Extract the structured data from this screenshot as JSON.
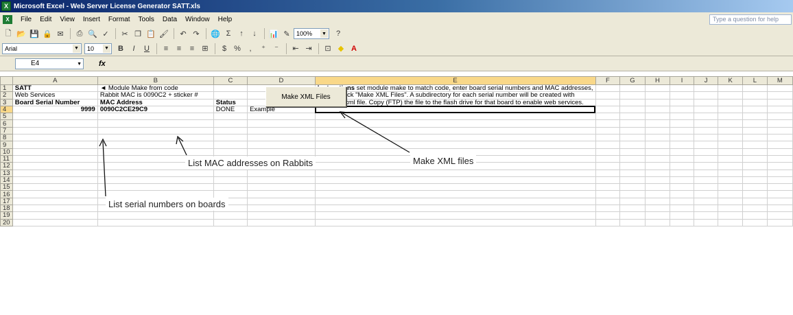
{
  "window": {
    "title": "Microsoft Excel - Web Server License Generator SATT.xls",
    "app_badge": "X"
  },
  "menu": {
    "items": [
      "File",
      "Edit",
      "View",
      "Insert",
      "Format",
      "Tools",
      "Data",
      "Window",
      "Help"
    ],
    "help_placeholder": "Type a question for help"
  },
  "toolbar": {
    "zoom": "100%",
    "font_name": "Arial",
    "font_size": "10",
    "bold": "B",
    "italic": "I",
    "underline": "U",
    "currency": "$",
    "percent": "%",
    "comma": ","
  },
  "formula_bar": {
    "name_box": "E4",
    "fx": "fx",
    "content": ""
  },
  "grid": {
    "columns": [
      "A",
      "B",
      "C",
      "D",
      "E",
      "F",
      "G",
      "H",
      "I",
      "J",
      "K",
      "L",
      "M"
    ],
    "selected_column": "E",
    "selected_row": "4",
    "rows": [
      "1",
      "2",
      "3",
      "4",
      "5",
      "6",
      "7",
      "8",
      "9",
      "10",
      "11",
      "12",
      "13",
      "14",
      "15",
      "16",
      "17",
      "18",
      "19",
      "20"
    ],
    "cells": {
      "A1": "SATT",
      "A2": "Web Services",
      "A3": "Board Serial Number",
      "A4": "9999",
      "B1": "◄ Module Make from code",
      "B2": "Rabbit MAC is 0090C2 + sticker #",
      "B3": "MAC Address",
      "B4": "0090C2CE29C9",
      "C3": "Status",
      "C4": "DONE",
      "D4": "Example",
      "E1_bold": "Instructions",
      "E1": " set module make to match code, enter board serial numbers and MAC addresses,",
      "E2": "then on click \"Make XML Files\".  A subdirectory for each serial number will be created with",
      "E3": "a license xml file.  Copy (FTP) the file to the flash drive for that board to enable web services."
    }
  },
  "button": {
    "make_xml": "Make XML Files"
  },
  "annotations": {
    "mac": "List MAC addresses on Rabbits",
    "xml": "Make XML files",
    "serial": "List serial numbers on boards"
  }
}
